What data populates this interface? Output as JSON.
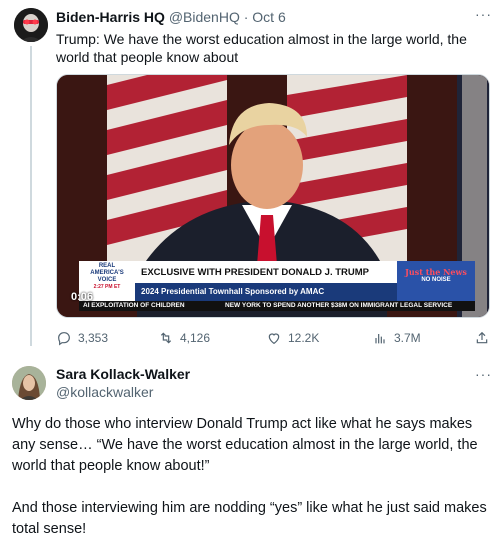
{
  "tweet": {
    "author_name": "Biden-Harris HQ",
    "handle": "@BidenHQ",
    "separator": "·",
    "date": "Oct 6",
    "more_label": "···",
    "text": "Trump: We have the worst education almost in the large world, the world that people know about",
    "video": {
      "time": "0:06",
      "chyron_main": "EXCLUSIVE WITH PRESIDENT DONALD J. TRUMP",
      "chyron_sub": "2024 Presidential Townhall Sponsored by AMAC",
      "ticker_left": "AI EXPLOITATION OF CHILDREN",
      "ticker_right": "NEW YORK TO SPEND ANOTHER $38M ON IMMIGRANT LEGAL SERVICE",
      "badge_line1": "REAL",
      "badge_line2": "AMERICA'S",
      "badge_line3": "VOICE",
      "badge_time": "2:27 PM ET",
      "logo_line1": "Just the News",
      "logo_line2": "NO NOISE"
    },
    "stats": {
      "replies": "3,353",
      "reposts": "4,126",
      "likes": "12.2K",
      "views": "3.7M"
    }
  },
  "reply": {
    "author_name": "Sara Kollack-Walker",
    "handle": "@kollackwalker",
    "more_label": "···",
    "text": "Why do those who interview Donald Trump act like what he says makes any sense… “We have the worst education almost in the large world, the world that people know about!”\n\nAnd those interviewing him are nodding “yes” like what he just said makes total sense!"
  },
  "colors": {
    "text": "#0f1419",
    "muted": "#536471",
    "thread_line": "#cfd9de",
    "chyron_blue": "#1a3a7a",
    "ticker_black": "#111111",
    "flag_red": "#b22234"
  }
}
